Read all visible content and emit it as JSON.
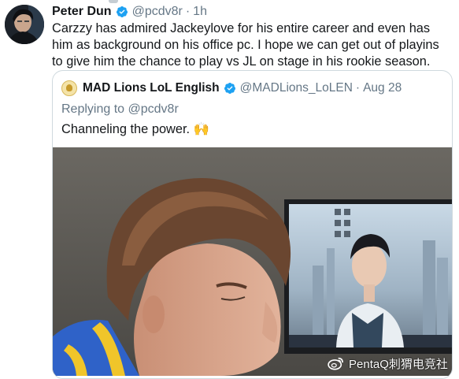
{
  "tweet": {
    "author_name": "Peter Dun",
    "handle": "@pcdv8r",
    "separator": "·",
    "time": "1h",
    "text": "Carzzy has admired Jackeylove for his entire career and even has him as background on his office pc. I hope we can get out of playins to give him the chance to play vs JL on stage in his rookie season."
  },
  "quoted_tweet": {
    "author_name": "MAD Lions LoL English",
    "handle": "@MADLions_LoLEN",
    "separator": "·",
    "date": "Aug 28",
    "replying_prefix": "Replying to",
    "replying_to": "@pcdv8r",
    "text": "Channeling the power. 🙌"
  },
  "watermark": {
    "text": "PentaQ刺猬电竞社",
    "icon": "weibo-icon"
  },
  "colors": {
    "verified": "#1da1f2",
    "text_primary": "#14171a",
    "text_muted": "#657786",
    "border": "#cfd9de"
  }
}
